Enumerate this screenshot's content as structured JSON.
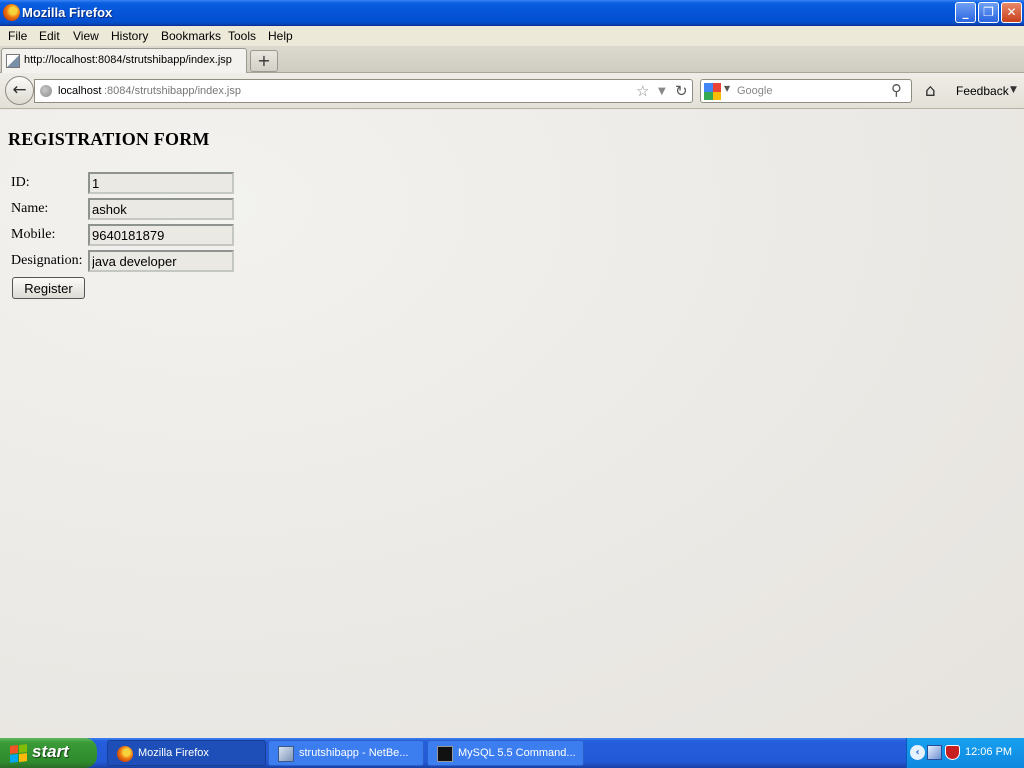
{
  "window": {
    "title": "Mozilla Firefox",
    "min_glyph": "_",
    "max_glyph": "❐",
    "close_glyph": "✕"
  },
  "menu": [
    "File",
    "Edit",
    "View",
    "History",
    "Bookmarks",
    "Tools",
    "Help"
  ],
  "tab": {
    "label": "http://localhost:8084/strutshibapp/index.jsp",
    "new_tab_glyph": "+"
  },
  "nav": {
    "url_host": "localhost",
    "url_path": ":8084/strutshibapp/index.jsp",
    "search_placeholder": "Google",
    "feedback": "Feedback",
    "back_glyph": "←",
    "star_glyph": "☆",
    "dropdown_glyph": "▼",
    "reload_glyph": "↻",
    "magnifier_glyph": "⚲",
    "home_glyph": "⌂"
  },
  "form": {
    "title": "REGISTRATION FORM",
    "fields": [
      {
        "label": "ID:",
        "value": "1"
      },
      {
        "label": "Name:",
        "value": "ashok"
      },
      {
        "label": "Mobile:",
        "value": "9640181879"
      },
      {
        "label": "Designation:",
        "value": "java developer"
      }
    ],
    "submit": "Register"
  },
  "taskbar": {
    "start": "start",
    "tasks": [
      {
        "label": "Mozilla Firefox",
        "active": true
      },
      {
        "label": "strutshibapp - NetBe...",
        "active": false
      },
      {
        "label": "MySQL 5.5 Command...",
        "active": false
      }
    ],
    "clock": "12:06 PM",
    "tray_expand_glyph": "‹"
  },
  "colors": {
    "titlebar": "#0554d8",
    "taskbar": "#245edc",
    "start_button": "#3a9b37",
    "page_background": "#ebe9e4"
  }
}
